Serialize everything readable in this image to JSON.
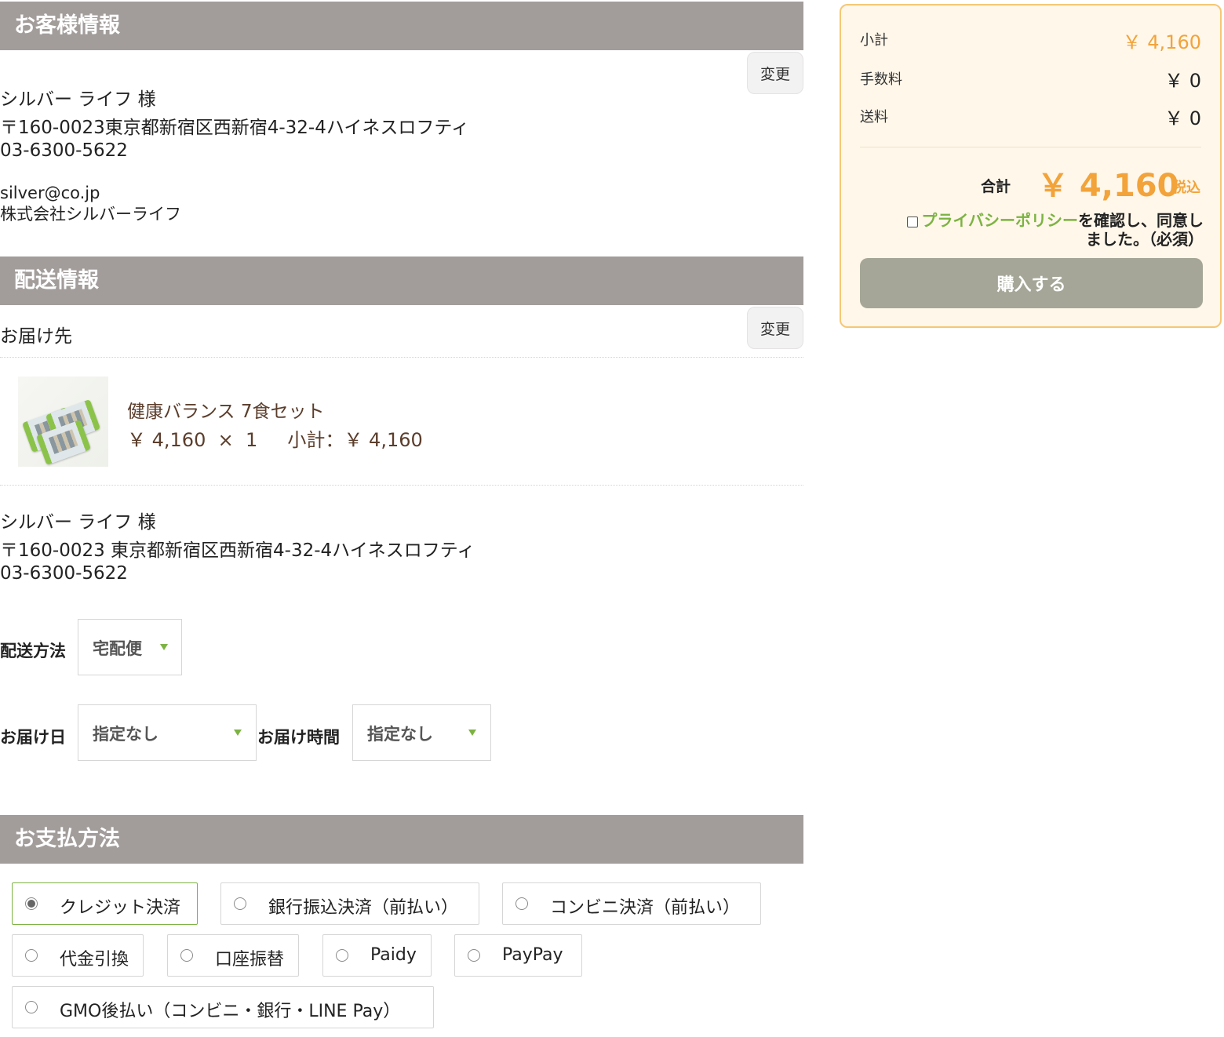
{
  "customer": {
    "heading": "お客様情報",
    "change_label": "変更",
    "name": "シルバー ライフ 様",
    "address": "〒160-0023東京都新宿区西新宿4-32-4ハイネスロフティ",
    "phone": "03-6300-5622",
    "email": "silver@co.jp",
    "company": "株式会社シルバーライフ"
  },
  "delivery": {
    "heading": "配送情報",
    "destination_label": "お届け先",
    "change_label": "変更",
    "product": {
      "name": "健康バランス 7食セット",
      "price": "￥ 4,160",
      "times": "×",
      "qty": "1",
      "subtotal_label": "小計：",
      "subtotal": "￥ 4,160"
    },
    "recipient_name": "シルバー ライフ 様",
    "recipient_address": "〒160-0023 東京都新宿区西新宿4-32-4ハイネスロフティ",
    "recipient_phone": "03-6300-5622",
    "method_label": "配送方法",
    "method_value": "宅配便",
    "date_label": "お届け日",
    "date_value": "指定なし",
    "time_label": "お届け時間",
    "time_value": "指定なし"
  },
  "payment": {
    "heading": "お支払方法",
    "options": [
      {
        "label": "クレジット決済",
        "selected": true
      },
      {
        "label": "銀行振込決済（前払い）",
        "selected": false
      },
      {
        "label": "コンビニ決済（前払い）",
        "selected": false
      },
      {
        "label": "代金引換",
        "selected": false
      },
      {
        "label": "口座振替",
        "selected": false
      },
      {
        "label": "Paidy",
        "selected": false
      },
      {
        "label": "PayPay",
        "selected": false
      },
      {
        "label": "GMO後払い（コンビニ・銀行・LINE Pay）",
        "selected": false
      }
    ]
  },
  "summary": {
    "subtotal_label": "小計",
    "subtotal": "￥ 4,160",
    "fee_label": "手数料",
    "fee": "￥ 0",
    "shipping_label": "送料",
    "shipping": "￥ 0",
    "total_label": "合計",
    "total": "￥ 4,160",
    "tax_label": "税込",
    "privacy_link": "プライバシーポリシー",
    "privacy_text_1": "を確認し、同意し",
    "privacy_text_2": "ました。（必須）",
    "buy_label": "購入する"
  },
  "colors": {
    "header_bg": "#a29d9b",
    "accent_green": "#7cb342",
    "accent_orange": "#f2a33a",
    "summary_border": "#f5c775",
    "summary_bg": "#fff7ea",
    "buy_button": "#a5a697"
  }
}
